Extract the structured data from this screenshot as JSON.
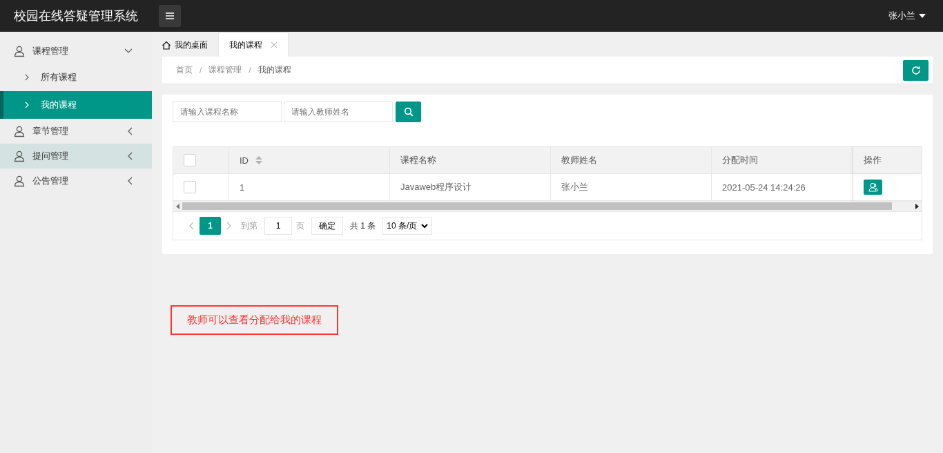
{
  "header": {
    "title": "校园在线答疑管理系统",
    "user": "张小兰"
  },
  "sidebar": {
    "items": [
      {
        "label": "课程管理",
        "expanded": true,
        "highlighted": false,
        "children": [
          {
            "label": "所有课程",
            "selected": false
          },
          {
            "label": "我的课程",
            "selected": true
          }
        ]
      },
      {
        "label": "章节管理",
        "expanded": false,
        "highlighted": false
      },
      {
        "label": "提问管理",
        "expanded": false,
        "highlighted": true
      },
      {
        "label": "公告管理",
        "expanded": false,
        "highlighted": false
      }
    ]
  },
  "tabs": [
    {
      "label": "我的桌面",
      "kind": "home",
      "selected": false
    },
    {
      "label": "我的课程",
      "kind": "closable",
      "selected": true
    }
  ],
  "breadcrumb": {
    "separator": "/",
    "items": [
      "首页",
      "课程管理",
      "我的课程"
    ]
  },
  "search": {
    "fields": [
      {
        "placeholder": "请输入课程名称"
      },
      {
        "placeholder": "请输入教师姓名"
      }
    ]
  },
  "table": {
    "header_checked": false,
    "columns": [
      {
        "label": "ID",
        "sortable": true
      },
      {
        "label": "课程名称",
        "sortable": false
      },
      {
        "label": "教师姓名",
        "sortable": false
      },
      {
        "label": "分配时间",
        "sortable": false
      },
      {
        "label": "操作",
        "sortable": false
      }
    ],
    "rows": [
      {
        "checked": false,
        "cells": [
          "1",
          "Javaweb程序设计",
          "张小兰",
          "2021-05-24 14:24:26"
        ]
      }
    ]
  },
  "pagination": {
    "pages": [
      {
        "label": "1",
        "selected": true
      }
    ],
    "goto_label": "到第",
    "goto_value": "1",
    "page_suffix": "页",
    "confirm": "确定",
    "total": "共 1 条",
    "page_size": "10 条/页"
  },
  "annotation": {
    "text": "教师可以查看分配给我的课程"
  }
}
